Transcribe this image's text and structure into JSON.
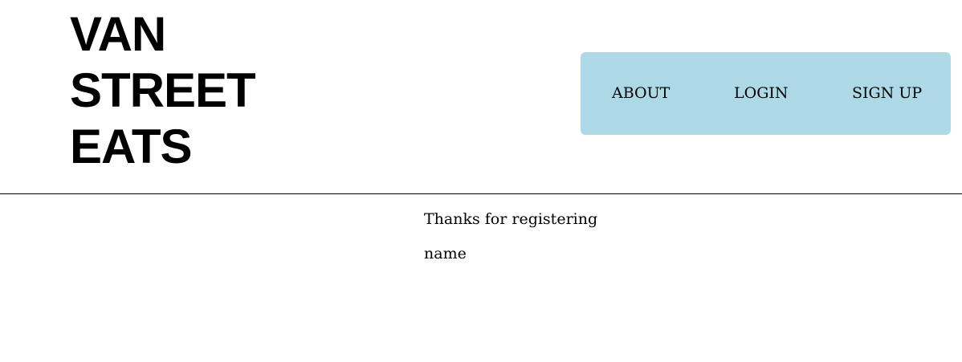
{
  "header": {
    "logo_lines": [
      "VAN",
      "STREET",
      "EATS"
    ],
    "nav": {
      "background": "#ADD8E6",
      "items": [
        {
          "label": "ABOUT"
        },
        {
          "label": "LOGIN"
        },
        {
          "label": "SIGN UP"
        }
      ]
    }
  },
  "main": {
    "thanks_text": "Thanks for registering",
    "name_text": "name"
  }
}
